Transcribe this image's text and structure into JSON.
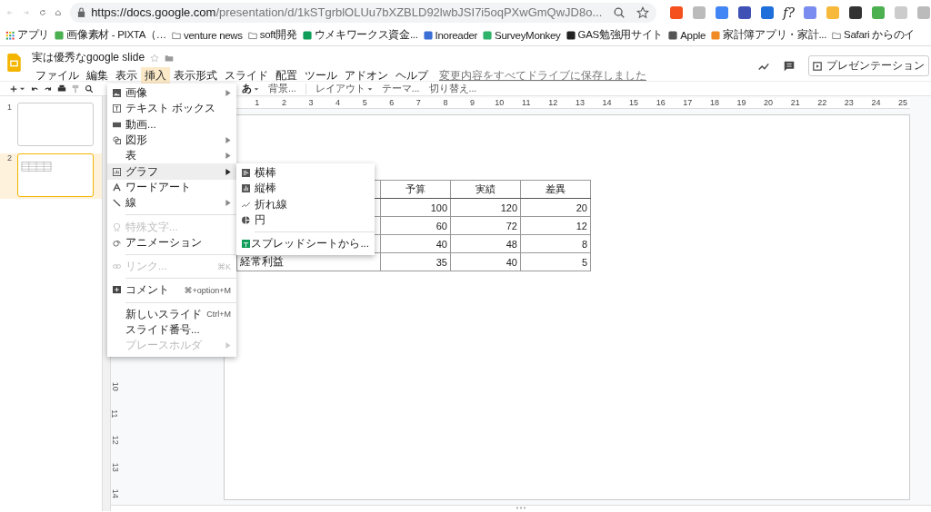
{
  "browser": {
    "url_host": "https://docs.google.com",
    "url_path": "/presentation/d/1kSTgrblOLUu7bXZBLD92lwbJSI7i5oqPXwGmQwJD8o...",
    "extension_text": "f?",
    "bookmarks": [
      {
        "label": "アプリ",
        "kind": "apps"
      },
      {
        "label": "画像素材 - PIXTA（…",
        "kind": "site"
      },
      {
        "label": "venture news",
        "kind": "folder"
      },
      {
        "label": "soft開発",
        "kind": "folder"
      },
      {
        "label": "ウメキワークス資金...",
        "kind": "site"
      },
      {
        "label": "Inoreader",
        "kind": "site"
      },
      {
        "label": "SurveyMonkey",
        "kind": "site"
      },
      {
        "label": "GAS勉強用サイト",
        "kind": "site"
      },
      {
        "label": "Apple",
        "kind": "site"
      },
      {
        "label": "家計簿アプリ・家計...",
        "kind": "site"
      },
      {
        "label": "Safari からのイ",
        "kind": "folder"
      }
    ]
  },
  "document": {
    "title": "実は優秀なgoogle slide",
    "save_status": "変更内容をすべてドライブに保存しました",
    "present_button": "プレゼンテーション",
    "menus": [
      {
        "label": "ファイル",
        "selected": false
      },
      {
        "label": "編集",
        "selected": false
      },
      {
        "label": "表示",
        "selected": false
      },
      {
        "label": "挿入",
        "selected": true
      },
      {
        "label": "表示形式",
        "selected": false
      },
      {
        "label": "スライド",
        "selected": false
      },
      {
        "label": "配置",
        "selected": false
      },
      {
        "label": "ツール",
        "selected": false
      },
      {
        "label": "アドオン",
        "selected": false
      },
      {
        "label": "ヘルプ",
        "selected": false
      }
    ]
  },
  "toolbar": {
    "items": [
      {
        "label": "あ",
        "kind": "dropdown"
      },
      {
        "label": "背景...",
        "kind": "button"
      },
      {
        "label": "レイアウト",
        "kind": "dropdown"
      },
      {
        "label": "テーマ...",
        "kind": "button"
      },
      {
        "label": "切り替え...",
        "kind": "button"
      }
    ]
  },
  "filmstrip": {
    "slides": [
      {
        "number": "1",
        "selected": false,
        "kind": "blank"
      },
      {
        "number": "2",
        "selected": true,
        "kind": "table"
      }
    ]
  },
  "ruler": {
    "horizontal": [
      "1",
      "2",
      "3",
      "4",
      "5",
      "6",
      "7",
      "8",
      "9",
      "10",
      "11",
      "12",
      "13",
      "14",
      "15",
      "16",
      "17",
      "18",
      "19",
      "20",
      "21",
      "22",
      "23",
      "24",
      "25"
    ],
    "vertical": [
      "10",
      "11",
      "12",
      "13",
      "14"
    ]
  },
  "table": {
    "columns": [
      "予算",
      "実績",
      "差異"
    ],
    "rows": [
      {
        "cells": [
          "100",
          "120",
          "20"
        ]
      },
      {
        "cells": [
          "60",
          "72",
          "12"
        ]
      },
      {
        "cells": [
          "40",
          "48",
          "8"
        ]
      },
      {
        "label": "経常利益",
        "cells": [
          "35",
          "40",
          "5"
        ]
      }
    ]
  },
  "insert_menu": {
    "items": [
      {
        "kind": "item",
        "label": "画像",
        "submenu": true,
        "disabled": false,
        "highlighted": false
      },
      {
        "kind": "item",
        "label": "テキスト ボックス",
        "submenu": false,
        "disabled": false,
        "highlighted": false
      },
      {
        "kind": "item",
        "label": "動画...",
        "submenu": false,
        "disabled": false,
        "highlighted": false
      },
      {
        "kind": "item",
        "label": "図形",
        "submenu": true,
        "disabled": false,
        "highlighted": false
      },
      {
        "kind": "item",
        "label": "表",
        "submenu": true,
        "disabled": false,
        "highlighted": false
      },
      {
        "kind": "item",
        "label": "グラフ",
        "submenu": true,
        "disabled": false,
        "highlighted": true
      },
      {
        "kind": "item",
        "label": "ワードアート",
        "submenu": false,
        "disabled": false,
        "highlighted": false
      },
      {
        "kind": "item",
        "label": "線",
        "submenu": true,
        "disabled": false,
        "highlighted": false
      },
      {
        "kind": "separator"
      },
      {
        "kind": "item",
        "label": "特殊文字...",
        "submenu": false,
        "disabled": true,
        "highlighted": false
      },
      {
        "kind": "item",
        "label": "アニメーション",
        "submenu": false,
        "disabled": false,
        "highlighted": false
      },
      {
        "kind": "separator"
      },
      {
        "kind": "item",
        "label": "リンク...",
        "shortcut": "⌘K",
        "submenu": false,
        "disabled": true,
        "highlighted": false
      },
      {
        "kind": "separator"
      },
      {
        "kind": "item",
        "label": "コメント",
        "shortcut": "⌘+option+M",
        "submenu": false,
        "disabled": false,
        "highlighted": false
      },
      {
        "kind": "separator"
      },
      {
        "kind": "item",
        "label": "新しいスライド",
        "shortcut": "Ctrl+M",
        "submenu": false,
        "disabled": false,
        "highlighted": false
      },
      {
        "kind": "item",
        "label": "スライド番号...",
        "submenu": false,
        "disabled": false,
        "highlighted": false
      },
      {
        "kind": "item",
        "label": "プレースホルダ",
        "submenu": true,
        "disabled": true,
        "highlighted": false
      }
    ]
  },
  "chart_submenu": {
    "items": [
      {
        "kind": "item",
        "label": "横棒"
      },
      {
        "kind": "item",
        "label": "縦棒"
      },
      {
        "kind": "item",
        "label": "折れ線"
      },
      {
        "kind": "item",
        "label": "円"
      },
      {
        "kind": "separator"
      },
      {
        "kind": "item",
        "label": "スプレッドシートから..."
      }
    ]
  }
}
